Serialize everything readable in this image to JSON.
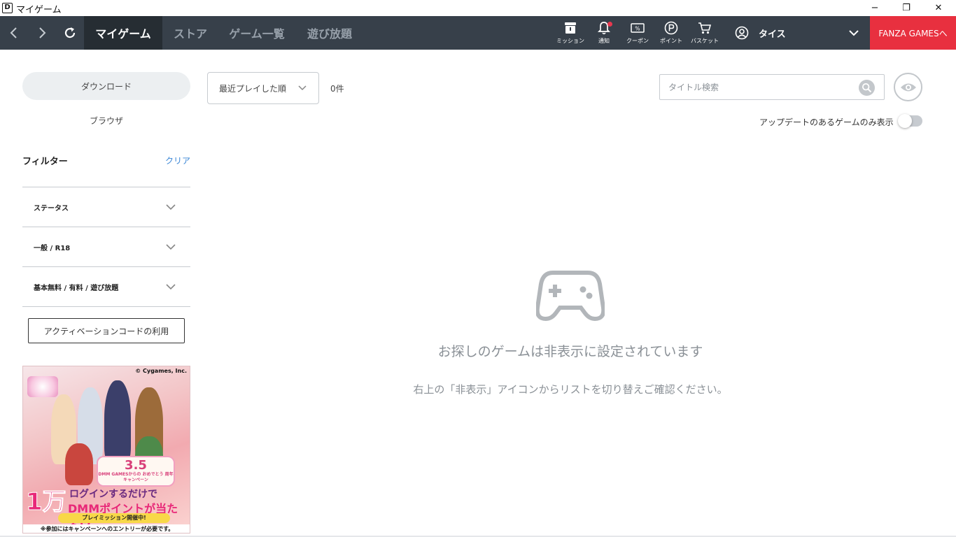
{
  "window": {
    "title": "マイゲーム",
    "app_icon_letter": "D",
    "controls": {
      "minimize": "−",
      "maximize": "❐",
      "close": "✕"
    }
  },
  "navbar": {
    "tabs": [
      {
        "label": "マイゲーム",
        "active": true
      },
      {
        "label": "ストア",
        "active": false
      },
      {
        "label": "ゲーム一覧",
        "active": false
      },
      {
        "label": "遊び放題",
        "active": false
      }
    ],
    "tools": [
      {
        "label": "ミッション",
        "icon": "mission-icon"
      },
      {
        "label": "通知",
        "icon": "bell-icon",
        "has_badge": true
      },
      {
        "label": "クーポン",
        "icon": "coupon-icon"
      },
      {
        "label": "ポイント",
        "icon": "point-icon"
      },
      {
        "label": "バスケット",
        "icon": "cart-icon"
      }
    ],
    "user_name": "タイス",
    "fanza_button": "FANZA GAMESへ",
    "colors": {
      "bar": "#37404a",
      "active_tab": "#262d33",
      "fanza": "#e8303f",
      "badge": "#e8384f"
    }
  },
  "sidebar": {
    "segments": {
      "download": "ダウンロード",
      "browser": "ブラウザ"
    },
    "filter_title": "フィルター",
    "clear_label": "クリア",
    "filters": [
      {
        "label": "ステータス"
      },
      {
        "label": "一般 / R18"
      },
      {
        "label": "基本無料 / 有料 / 遊び放題"
      }
    ],
    "activation_button": "アクティベーションコードの利用",
    "banner": {
      "copyright": "© Cygames, Inc.",
      "anniversary": "3.5",
      "anniversary_sub": "DMM GAMESからの おめでとう 周年 キャンペーン",
      "headline_big": "1万",
      "headline_login": "ログインするだけで",
      "headline_points": "DMMポイントが当たる!?",
      "ribbon": "プレイミッション開催中!",
      "note": "※参加にはキャンペーンへのエントリーが必要です。"
    }
  },
  "toolbar": {
    "sort_selected": "最近プレイした順",
    "count": "0件",
    "search_placeholder": "タイトル検索",
    "update_only_label": "アップデートのあるゲームのみ表示",
    "update_only_enabled": false
  },
  "empty_state": {
    "icon": "gamepad-icon",
    "title": "お探しのゲームは非表示に設定されています",
    "description": "右上の「非表示」アイコンからリストを切り替えご確認ください。"
  }
}
